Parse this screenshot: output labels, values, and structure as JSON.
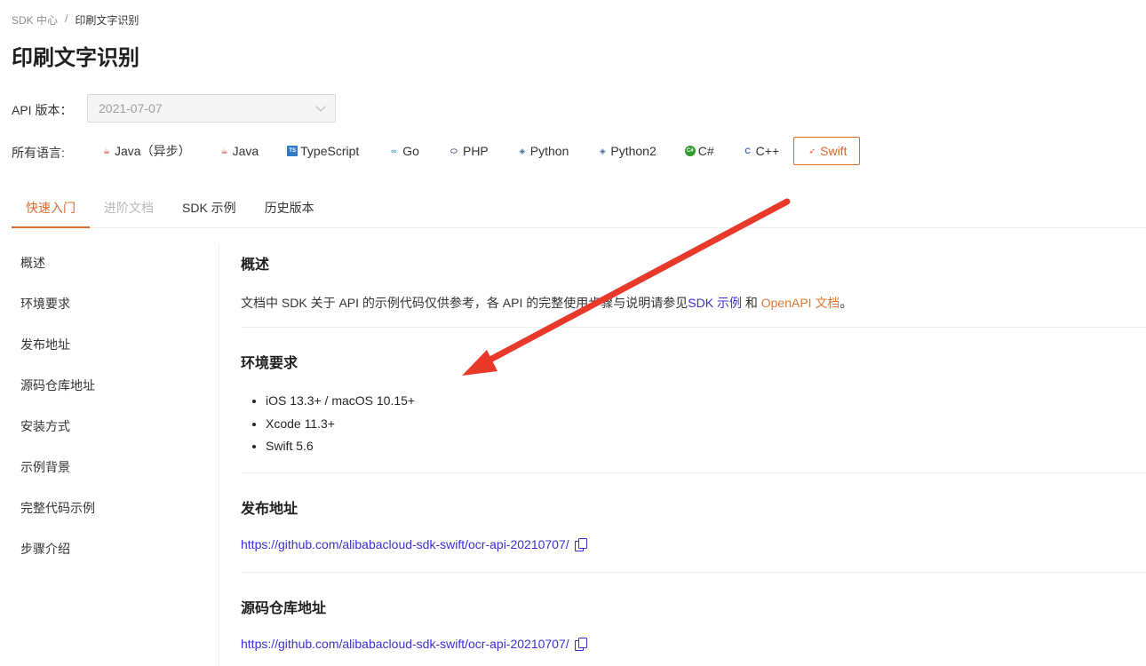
{
  "breadcrumb": {
    "root": "SDK 中心",
    "separator": "/",
    "current": "印刷文字识别"
  },
  "page_title": "印刷文字识别",
  "api_version": {
    "label": "API 版本：",
    "value": "2021-07-07"
  },
  "languages": {
    "label": "所有语言:",
    "items": [
      {
        "label": "Java（异步）",
        "icon": "java-icon"
      },
      {
        "label": "Java",
        "icon": "java-icon"
      },
      {
        "label": "TypeScript",
        "icon": "typescript-icon"
      },
      {
        "label": "Go",
        "icon": "go-icon"
      },
      {
        "label": "PHP",
        "icon": "php-icon"
      },
      {
        "label": "Python",
        "icon": "python-icon"
      },
      {
        "label": "Python2",
        "icon": "python-icon"
      },
      {
        "label": "C#",
        "icon": "csharp-icon"
      },
      {
        "label": "C++",
        "icon": "cpp-icon"
      },
      {
        "label": "Swift",
        "icon": "swift-icon"
      }
    ],
    "selected": "Swift"
  },
  "tabs": [
    {
      "label": "快速入门",
      "state": "active"
    },
    {
      "label": "进阶文档",
      "state": "disabled"
    },
    {
      "label": "SDK 示例",
      "state": "normal"
    },
    {
      "label": "历史版本",
      "state": "normal"
    }
  ],
  "sidebar": {
    "items": [
      {
        "label": "概述"
      },
      {
        "label": "环境要求"
      },
      {
        "label": "发布地址"
      },
      {
        "label": "源码仓库地址"
      },
      {
        "label": "安装方式"
      },
      {
        "label": "示例背景"
      },
      {
        "label": "完整代码示例"
      },
      {
        "label": "步骤介绍"
      }
    ]
  },
  "sections": {
    "overview": {
      "title": "概述",
      "text_before": "文档中 SDK 关于 API 的示例代码仅供参考，各 API 的完整使用步骤与说明请参见",
      "link1": "SDK 示例",
      "text_middle": " 和 ",
      "link2": "OpenAPI 文档",
      "text_after": "。"
    },
    "requirements": {
      "title": "环境要求",
      "items": [
        "iOS 13.3+ / macOS 10.15+",
        "Xcode 11.3+",
        "Swift 5.6"
      ]
    },
    "release": {
      "title": "发布地址",
      "url": "https://github.com/alibabacloud-sdk-swift/ocr-api-20210707/"
    },
    "repo": {
      "title": "源码仓库地址",
      "url": "https://github.com/alibabacloud-sdk-swift/ocr-api-20210707/"
    }
  },
  "colors": {
    "accent": "#d86a2b",
    "link": "#3d2fd4",
    "annotation": "#e8392b"
  }
}
